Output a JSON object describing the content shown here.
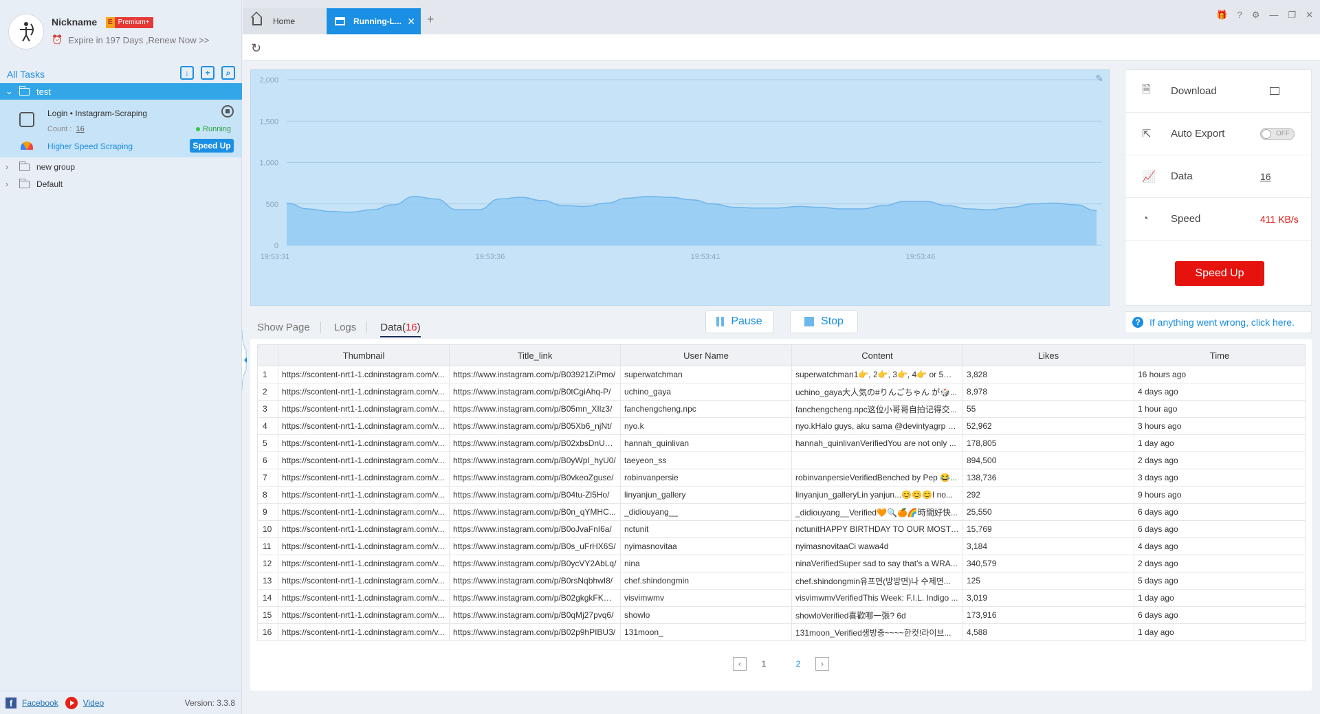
{
  "profile": {
    "nickname": "Nickname",
    "badge_e": "E",
    "badge_label": "Premium+",
    "expire": "Expire in 197 Days ,Renew Now >>"
  },
  "sidebar": {
    "all_tasks": "All Tasks",
    "active_group": "test",
    "task": {
      "name": "Login • Instagram-Scraping",
      "count_label": "Count :",
      "count": "16",
      "status": "Running",
      "hss": "Higher Speed Scraping",
      "speed_up": "Speed Up"
    },
    "groups": [
      "new group",
      "Default"
    ],
    "footer": {
      "facebook": "Facebook",
      "video": "Video",
      "version": "Version: 3.3.8"
    }
  },
  "tabs": {
    "home": "Home",
    "running": "Running-L..."
  },
  "chart_data": {
    "type": "area",
    "x_ticks": [
      "19:53:31",
      "19:53:36",
      "19:53:41",
      "19:53:46"
    ],
    "y_ticks": [
      "2,000",
      "1,500",
      "1,000",
      "500",
      "0"
    ],
    "ylim": [
      0,
      2000
    ],
    "grid": true,
    "x": [
      0,
      1,
      2,
      3,
      4,
      5,
      6,
      7,
      8,
      9,
      10,
      11,
      12,
      13,
      14,
      15,
      16,
      17,
      18,
      19,
      20,
      21,
      22,
      23,
      24,
      25,
      26,
      27,
      28,
      29,
      30,
      31,
      32,
      33,
      34,
      35,
      36,
      37,
      38
    ],
    "values": [
      510,
      440,
      410,
      400,
      430,
      490,
      590,
      560,
      430,
      430,
      560,
      580,
      540,
      480,
      470,
      510,
      570,
      590,
      580,
      550,
      500,
      460,
      450,
      450,
      470,
      460,
      440,
      440,
      480,
      530,
      530,
      480,
      440,
      430,
      460,
      500,
      510,
      490,
      420
    ],
    "series": [
      {
        "values_ref": "values"
      }
    ]
  },
  "panel": {
    "download": "Download",
    "auto_export": "Auto Export",
    "toggle": "OFF",
    "data": "Data",
    "data_value": "16",
    "speed": "Speed",
    "speed_value": "411 KB/s",
    "speed_up": "Speed Up"
  },
  "help": "If anything went wrong, click here.",
  "data_tabs": {
    "show_page": "Show Page",
    "logs": "Logs",
    "data": "Data(",
    "data_count": "16",
    "data_close": ")"
  },
  "actions": {
    "pause": "Pause",
    "stop": "Stop"
  },
  "table": {
    "headers": [
      "",
      "Thumbnail",
      "Title_link",
      "User Name",
      "Content",
      "Likes",
      "Time"
    ],
    "rows": [
      [
        "1",
        "https://scontent-nrt1-1.cdninstagram.com/v...",
        "https://www.instagram.com/p/B03921ZiPmo/",
        "superwatchman",
        "superwatchman1👉, 2👉, 3👉, 4👉 or 5👉...",
        "3,828",
        "16 hours ago"
      ],
      [
        "2",
        "https://scontent-nrt1-1.cdninstagram.com/v...",
        "https://www.instagram.com/p/B0tCgiAhq-P/",
        "uchino_gaya",
        "uchino_gaya大人気の#りんごちゃん が🎲...",
        "8,978",
        "4 days ago"
      ],
      [
        "3",
        "https://scontent-nrt1-1.cdninstagram.com/v...",
        "https://www.instagram.com/p/B05mn_XIlz3/",
        "fanchengcheng.npc",
        "fanchengcheng.npc这位小哥哥自拍记得交...",
        "55",
        "1 hour ago"
      ],
      [
        "4",
        "https://scontent-nrt1-1.cdninstagram.com/v...",
        "https://www.instagram.com/p/B05Xb6_njNt/",
        "nyo.k",
        "nyo.kHalo guys, aku sama @devintyagrp a...",
        "52,962",
        "3 hours ago"
      ],
      [
        "5",
        "https://scontent-nrt1-1.cdninstagram.com/v...",
        "https://www.instagram.com/p/B02xbsDnU2V/",
        "hannah_quinlivan",
        "hannah_quinlivanVerifiedYou are not only ...",
        "178,805",
        "1 day ago"
      ],
      [
        "6",
        "https://scontent-nrt1-1.cdninstagram.com/v...",
        "https://www.instagram.com/p/B0yWpI_hyU0/",
        "taeyeon_ss",
        "",
        "894,500",
        "2 days ago"
      ],
      [
        "7",
        "https://scontent-nrt1-1.cdninstagram.com/v...",
        "https://www.instagram.com/p/B0vkeoZguse/",
        "robinvanpersie",
        "robinvanpersieVerifiedBenched by Pep 😂...",
        "138,736",
        "3 days ago"
      ],
      [
        "8",
        "https://scontent-nrt1-1.cdninstagram.com/v...",
        "https://www.instagram.com/p/B04tu-Zl5Ho/",
        "linyanjun_gallery",
        "linyanjun_galleryLin yanjun...😊😊😊I no...",
        "292",
        "9 hours ago"
      ],
      [
        "9",
        "https://scontent-nrt1-1.cdninstagram.com/v...",
        "https://www.instagram.com/p/B0n_qYMHC...",
        "_didiouyang__",
        "_didiouyang__Verified🧡🔍🍊🌈時間好快...",
        "25,550",
        "6 days ago"
      ],
      [
        "10",
        "https://scontent-nrt1-1.cdninstagram.com/v...",
        "https://www.instagram.com/p/B0oJvaFnI6a/",
        "nctunit",
        "nctunitHAPPY BIRTHDAY TO OUR MOST ...",
        "15,769",
        "6 days ago"
      ],
      [
        "11",
        "https://scontent-nrt1-1.cdninstagram.com/v...",
        "https://www.instagram.com/p/B0s_uFrHX6S/",
        "nyimasnovitaa",
        "nyimasnovitaaCi wawa4d",
        "3,184",
        "4 days ago"
      ],
      [
        "12",
        "https://scontent-nrt1-1.cdninstagram.com/v...",
        "https://www.instagram.com/p/B0ycVY2AbLq/",
        "nina",
        "ninaVerifiedSuper sad to say that's a WRA...",
        "340,579",
        "2 days ago"
      ],
      [
        "13",
        "https://scontent-nrt1-1.cdninstagram.com/v...",
        "https://www.instagram.com/p/B0rsNqbhwI8/",
        "chef.shindongmin",
        "chef.shindongmin유프면(방방면)나 수제면...",
        "125",
        "5 days ago"
      ],
      [
        "14",
        "https://scontent-nrt1-1.cdninstagram.com/v...",
        "https://www.instagram.com/p/B02gkgkFKmT/",
        "visvimwmv",
        "visvimwmvVerifiedThis Week: F.I.L. Indigo ...",
        "3,019",
        "1 day ago"
      ],
      [
        "15",
        "https://scontent-nrt1-1.cdninstagram.com/v...",
        "https://www.instagram.com/p/B0qMj27pvq6/",
        "showlo",
        "showloVerified喜歡哪一張? 6d",
        "173,916",
        "6 days ago"
      ],
      [
        "16",
        "https://scontent-nrt1-1.cdninstagram.com/v...",
        "https://www.instagram.com/p/B02p9hPIBU3/",
        "131moon_",
        "131moon_Verified생방중~~~~한컷!라이브...",
        "4,588",
        "1 day ago"
      ]
    ]
  },
  "pager": {
    "pages": [
      "1",
      "2"
    ],
    "current": "2"
  },
  "colors": {
    "accent": "#1a8fe3",
    "danger": "#e6120d",
    "chart_fill": "#93cbf3",
    "chart_bg": "#c7e3f7"
  }
}
